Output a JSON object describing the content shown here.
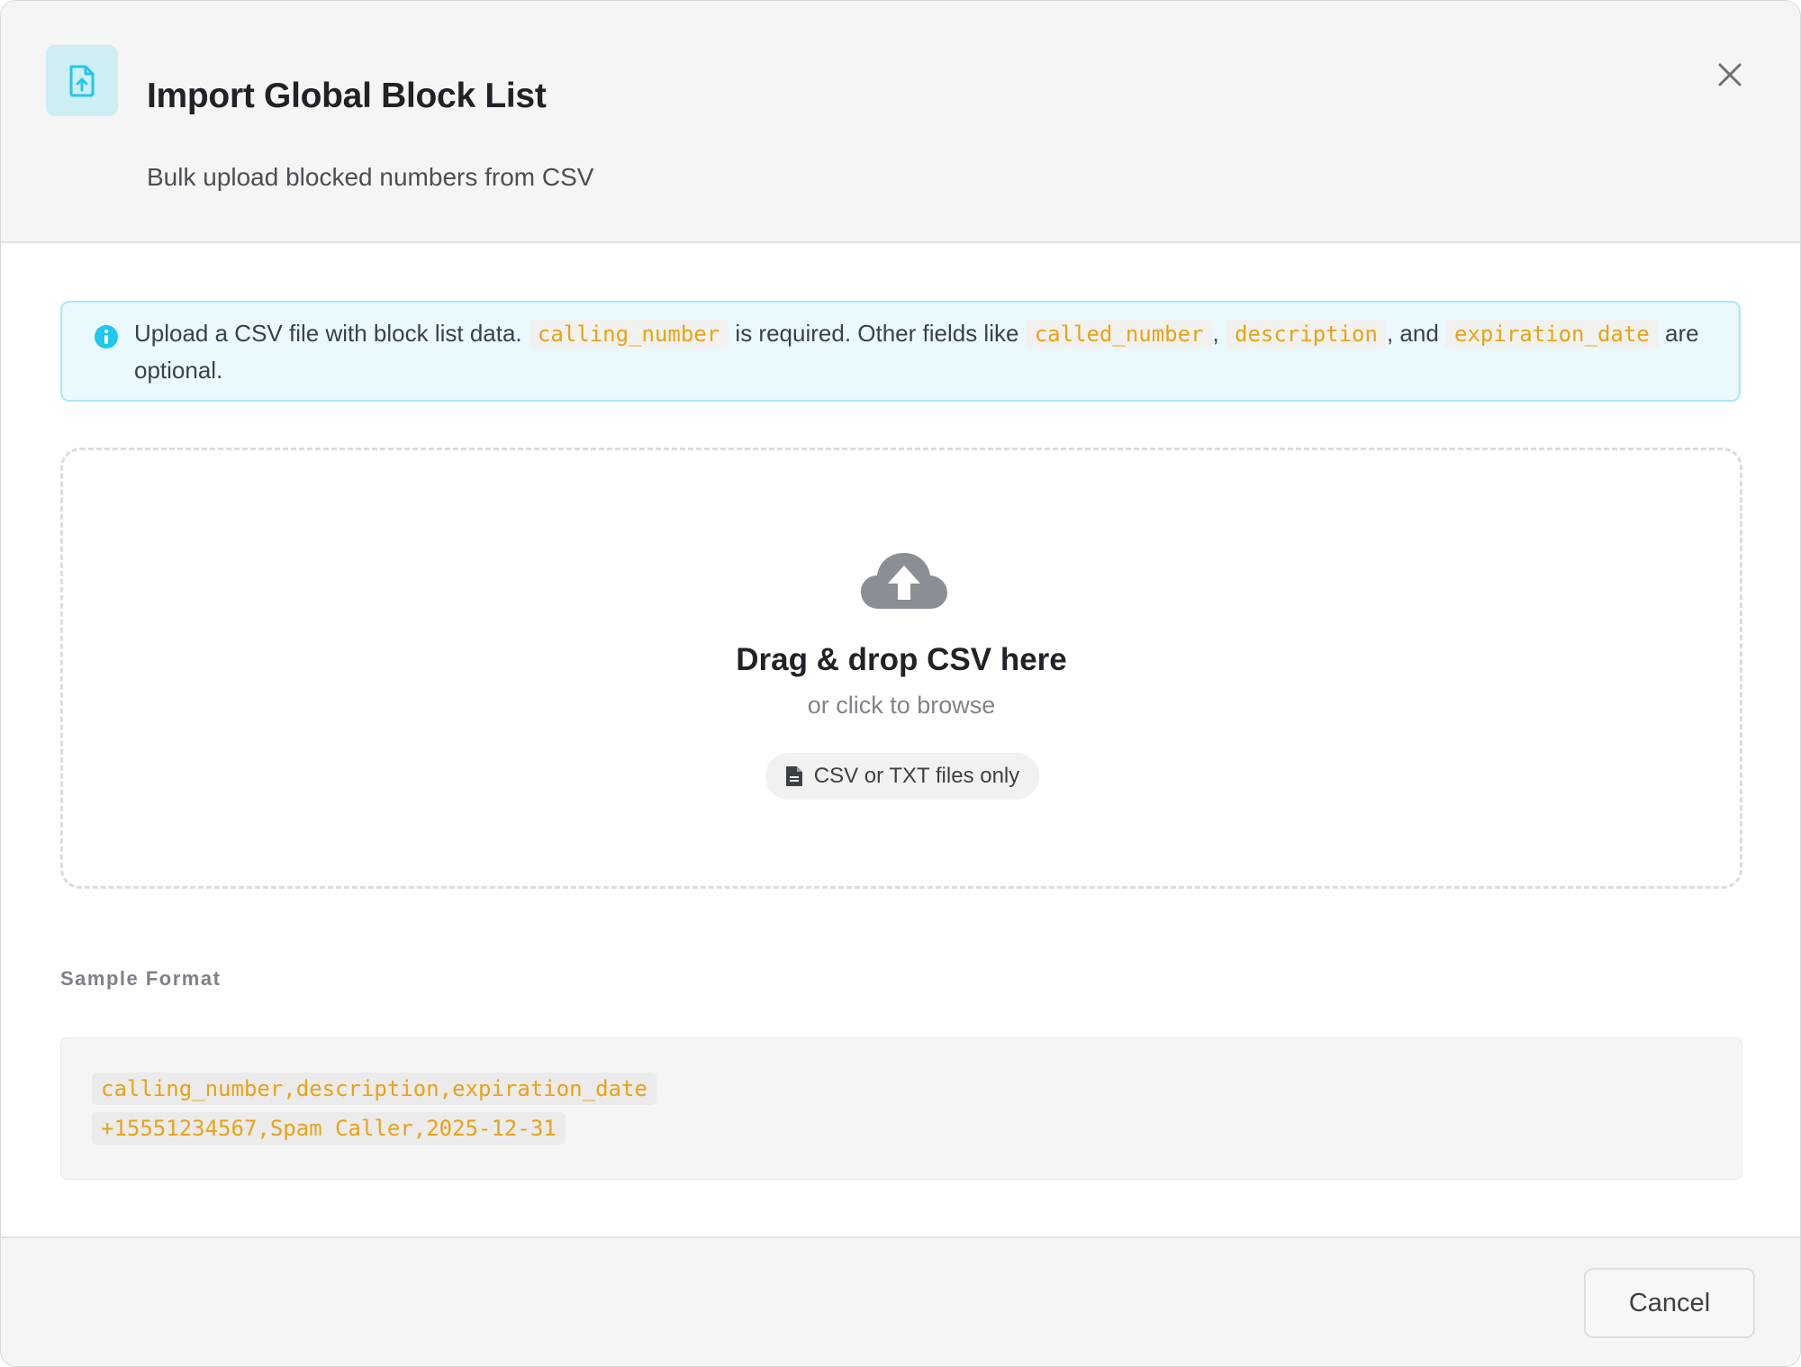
{
  "dialog": {
    "title": "Import Global Block List",
    "subtitle": "Bulk upload blocked numbers from CSV",
    "header_icon": "file-upload-icon",
    "close_icon": "close-icon"
  },
  "info": {
    "icon": "info-icon",
    "text_1": "Upload a CSV file with block list data.",
    "field_required": "calling_number",
    "text_2": "is required. Other fields like",
    "field_opt_1": "called_number",
    "sep_1": ",",
    "field_opt_2": "description",
    "text_3": ", and",
    "field_opt_3": "expiration_date",
    "text_4": "are optional."
  },
  "dropzone": {
    "icon": "cloud-upload-icon",
    "title": "Drag & drop CSV here",
    "subtitle": "or click to browse",
    "pill_icon": "file-icon",
    "pill_text": "CSV or TXT files only"
  },
  "sample": {
    "label": "Sample Format",
    "lines": [
      "calling_number,description,expiration_date",
      "+15551234567,Spam Caller,2025-12-31"
    ]
  },
  "footer": {
    "cancel_label": "Cancel"
  },
  "colors": {
    "accent": "#1ec8ee",
    "code": "#e8a317",
    "info_bg": "#e9f9fd"
  }
}
